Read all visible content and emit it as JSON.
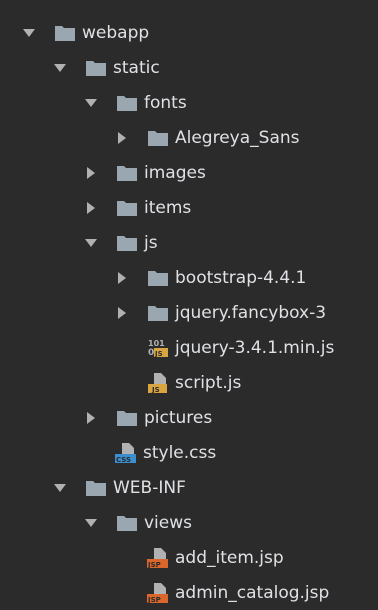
{
  "colors": {
    "background": "#2b2b2b",
    "text": "#dfe1e5",
    "folder": "#9aa7b0",
    "arrow": "#afb1b3",
    "js_badge": "#d9a540",
    "css_badge": "#3b8fcf",
    "jsp_badge": "#d9662a"
  },
  "tree": [
    {
      "label": "webapp",
      "expanded": true,
      "icon": "folder-icon"
    },
    {
      "label": "static",
      "expanded": true,
      "icon": "folder-icon"
    },
    {
      "label": "fonts",
      "expanded": true,
      "icon": "folder-icon"
    },
    {
      "label": "Alegreya_Sans",
      "expanded": false,
      "icon": "folder-icon"
    },
    {
      "label": "images",
      "expanded": false,
      "icon": "folder-icon"
    },
    {
      "label": "items",
      "expanded": false,
      "icon": "folder-icon"
    },
    {
      "label": "js",
      "expanded": true,
      "icon": "folder-icon"
    },
    {
      "label": "bootstrap-4.4.1",
      "expanded": false,
      "icon": "folder-icon"
    },
    {
      "label": "jquery.fancybox-3",
      "expanded": false,
      "icon": "folder-icon"
    },
    {
      "label": "jquery-3.4.1.min.js",
      "icon": "minified-js-file-icon",
      "badge": "JS",
      "badge_top": "101"
    },
    {
      "label": "script.js",
      "icon": "js-file-icon",
      "badge": "JS"
    },
    {
      "label": "pictures",
      "expanded": false,
      "icon": "folder-icon"
    },
    {
      "label": "style.css",
      "icon": "css-file-icon",
      "badge": "CSS"
    },
    {
      "label": "WEB-INF",
      "expanded": true,
      "icon": "folder-icon"
    },
    {
      "label": "views",
      "expanded": true,
      "icon": "folder-icon"
    },
    {
      "label": "add_item.jsp",
      "icon": "jsp-file-icon",
      "badge": "JSP"
    },
    {
      "label": "admin_catalog.jsp",
      "icon": "jsp-file-icon",
      "badge": "JSP"
    }
  ]
}
